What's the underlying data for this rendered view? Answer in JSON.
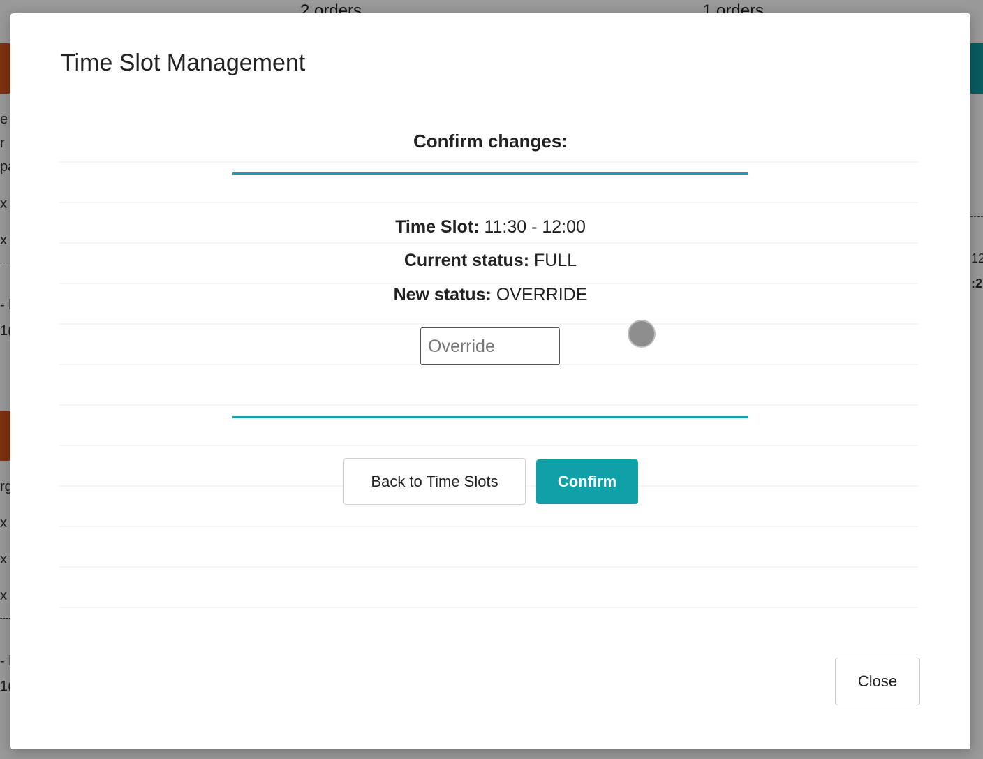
{
  "background": {
    "header_left": "2 orders",
    "header_right": "1 orders",
    "side_fragments_top": [
      "e",
      "r",
      "pa",
      "x",
      "x"
    ],
    "side_fragments_mid": [
      "- l",
      "1("
    ],
    "side_fragments_bottom": [
      "rg",
      "x",
      "x",
      "x"
    ],
    "side_fragments_end": [
      "- l",
      "1("
    ],
    "right_fragments": [
      "12",
      ":2"
    ]
  },
  "modal": {
    "title": "Time Slot Management",
    "confirm_heading": "Confirm changes:",
    "time_slot": {
      "label": "Time Slot:",
      "value": "11:30 - 12:00"
    },
    "current_status": {
      "label": "Current status:",
      "value": "FULL"
    },
    "new_status": {
      "label": "New status:",
      "value": "OVERRIDE"
    },
    "override_input": {
      "placeholder": "Override",
      "value": ""
    },
    "buttons": {
      "back": "Back to Time Slots",
      "confirm": "Confirm",
      "close": "Close"
    }
  },
  "colors": {
    "accent": "#10a0a8",
    "brand_logo": "#d0531c",
    "overlay": "rgba(0,0,0,0.40)"
  }
}
